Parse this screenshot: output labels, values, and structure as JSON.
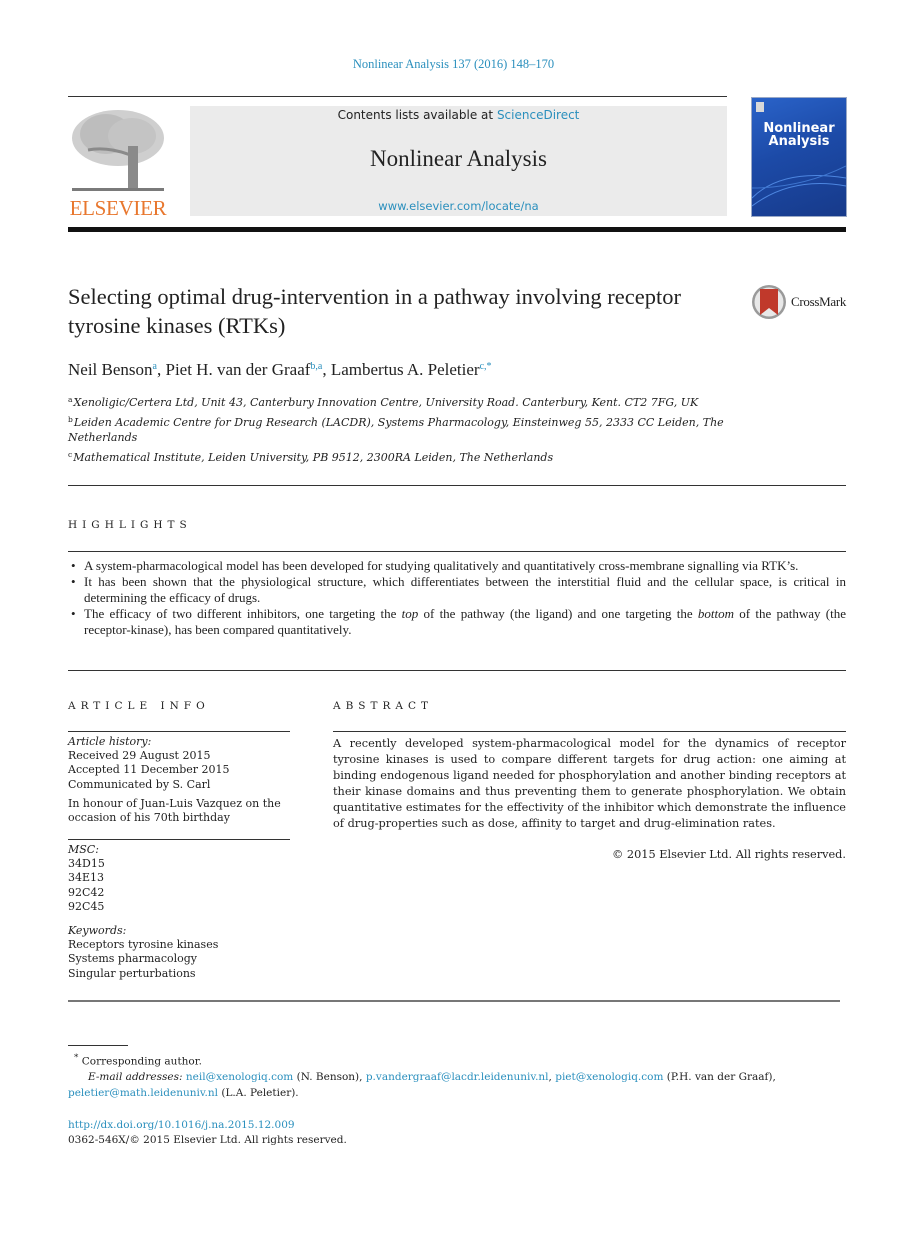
{
  "citation": "Nonlinear Analysis 137 (2016) 148–170",
  "masthead": {
    "contents_prefix": "Contents lists available at ",
    "contents_link": "ScienceDirect",
    "journal_name": "Nonlinear Analysis",
    "journal_url": "www.elsevier.com/locate/na",
    "publisher_logo_text": "ELSEVIER",
    "cover_title_line1": "Nonlinear",
    "cover_title_line2": "Analysis",
    "colors": {
      "publisher_orange": "#e8772e",
      "link_blue": "#2a8fbd",
      "cover_blue": "#1c4aa7"
    }
  },
  "article": {
    "title": "Selecting optimal drug-intervention in a pathway involving receptor tyrosine kinases (RTKs)",
    "crossmark_label": "CrossMark",
    "authors": [
      {
        "name": "Neil Benson",
        "marks": "a"
      },
      {
        "name": "Piet H. van der Graaf",
        "marks": "b,a"
      },
      {
        "name": "Lambertus A. Peletier",
        "marks": "c,*"
      }
    ],
    "affiliations": [
      {
        "mark": "a",
        "text": "Xenoligic/Certera Ltd, Unit 43, Canterbury Innovation Centre, University Road. Canterbury, Kent. CT2 7FG, UK"
      },
      {
        "mark": "b",
        "text": "Leiden Academic Centre for Drug Research (LACDR), Systems Pharmacology, Einsteinweg 55, 2333 CC Leiden, The Netherlands"
      },
      {
        "mark": "c",
        "text": "Mathematical Institute, Leiden University, PB 9512, 2300RA Leiden, The Netherlands"
      }
    ]
  },
  "highlights": {
    "heading": "HIGHLIGHTS",
    "items": [
      {
        "text": "A system-pharmacological model has been developed for studying qualitatively and quantitatively cross-membrane signalling via RTK’s."
      },
      {
        "text": "It has been shown that the physiological structure, which differentiates between the interstitial fluid and the cellular space, is critical in determining the efficacy of drugs."
      },
      {
        "pre": "The efficacy of two different inhibitors, one targeting the ",
        "em1": "top",
        "mid": " of the pathway (the ligand) and one targeting the ",
        "em2": "bottom",
        "post": " of the pathway (the receptor-kinase), has been compared quantitatively."
      }
    ]
  },
  "article_info": {
    "heading": "ARTICLE INFO",
    "history_label": "Article history:",
    "received": "Received 29 August 2015",
    "accepted": "Accepted 11 December 2015",
    "communicated": "Communicated by S. Carl",
    "dedication": "In honour of Juan-Luis Vazquez on the occasion of his 70th birthday",
    "msc_label": "MSC:",
    "msc": [
      "34D15",
      "34E13",
      "92C42",
      "92C45"
    ],
    "keywords_label": "Keywords:",
    "keywords": [
      "Receptors tyrosine kinases",
      "Systems pharmacology",
      "Singular perturbations"
    ]
  },
  "abstract": {
    "heading": "ABSTRACT",
    "text": "A recently developed system-pharmacological model for the dynamics of receptor tyrosine kinases is used to compare different targets for drug action: one aiming at binding endogenous ligand needed for phosphorylation and another binding receptors at their kinase domains and thus preventing them to generate phosphorylation. We obtain quantitative estimates for the effectivity of the inhibitor which demonstrate the influence of drug-properties such as dose, affinity to target and drug-elimination rates.",
    "copyright": "© 2015 Elsevier Ltd. All rights reserved."
  },
  "footnotes": {
    "corresponding_mark": "*",
    "corresponding_text": "Corresponding author.",
    "email_label": "E-mail addresses:",
    "emails": [
      {
        "address": "neil@xenologiq.com",
        "suffix": " (N. Benson), "
      },
      {
        "address": "p.vandergraaf@lacdr.leidenuniv.nl",
        "suffix": ", "
      },
      {
        "address": "piet@xenologiq.com",
        "suffix": " (P.H. van der Graaf), "
      },
      {
        "address": "peletier@math.leidenuniv.nl",
        "suffix": " (L.A. Peletier)."
      }
    ],
    "doi": "http://dx.doi.org/10.1016/j.na.2015.12.009",
    "issn": "0362-546X/© 2015 Elsevier Ltd. All rights reserved."
  }
}
